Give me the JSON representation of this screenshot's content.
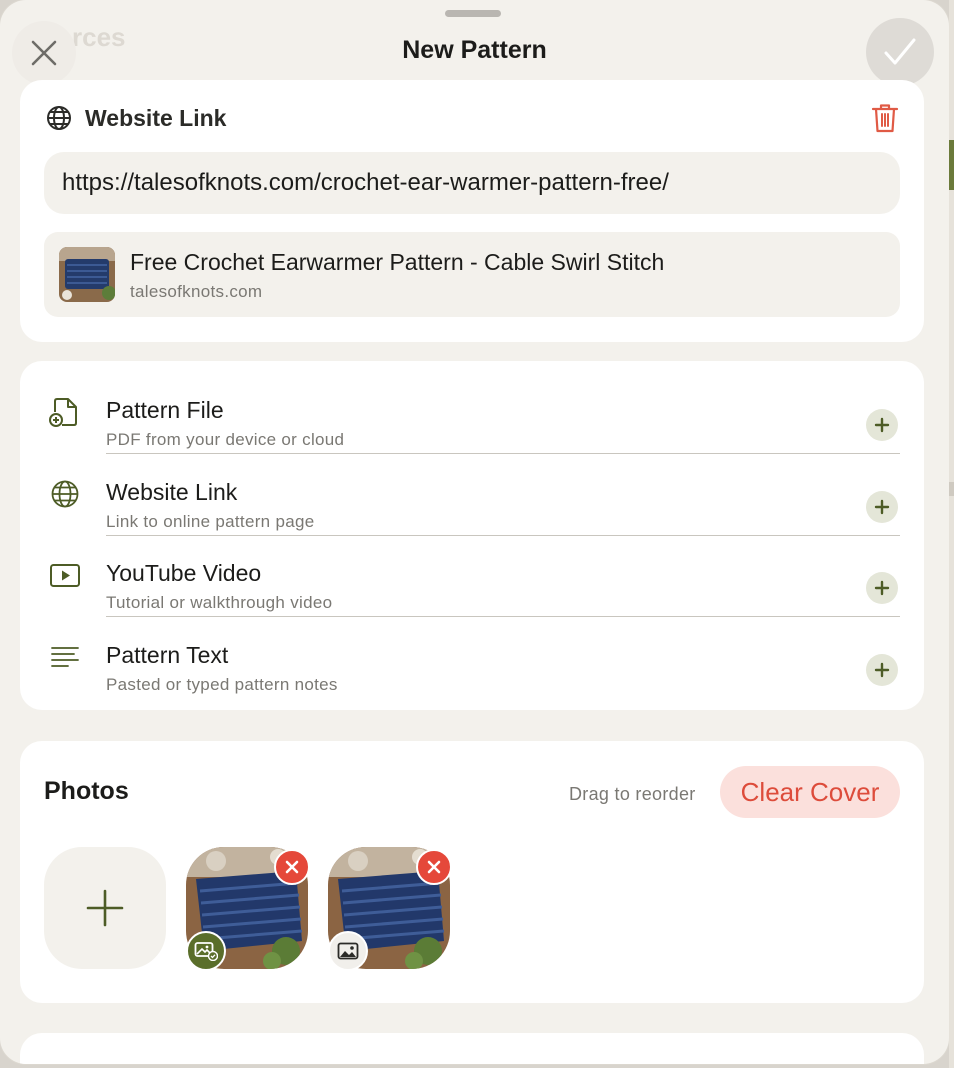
{
  "sheet": {
    "title": "New Pattern",
    "background_section_hint": "rces"
  },
  "website_link": {
    "label": "Website Link",
    "url": "https://talesofknots.com/crochet-ear-warmer-pattern-free/",
    "preview": {
      "title": "Free Crochet Earwarmer Pattern - Cable Swirl Stitch",
      "domain": "talesofknots.com"
    }
  },
  "attachments": [
    {
      "title": "Pattern File",
      "subtitle": "PDF from your device or cloud",
      "icon": "file-add-icon"
    },
    {
      "title": "Website Link",
      "subtitle": "Link to online pattern page",
      "icon": "globe-icon"
    },
    {
      "title": "YouTube Video",
      "subtitle": "Tutorial or walkthrough video",
      "icon": "video-play-icon"
    },
    {
      "title": "Pattern Text",
      "subtitle": "Pasted or typed pattern notes",
      "icon": "text-lines-icon"
    }
  ],
  "photos": {
    "title": "Photos",
    "drag_hint": "Drag to reorder",
    "clear_cover_label": "Clear Cover",
    "items": [
      {
        "is_cover": true
      },
      {
        "is_cover": false
      }
    ]
  },
  "colors": {
    "accent_olive": "#5a6e2a",
    "destructive_red": "#dd4c3b",
    "background": "#f3f1ec"
  }
}
